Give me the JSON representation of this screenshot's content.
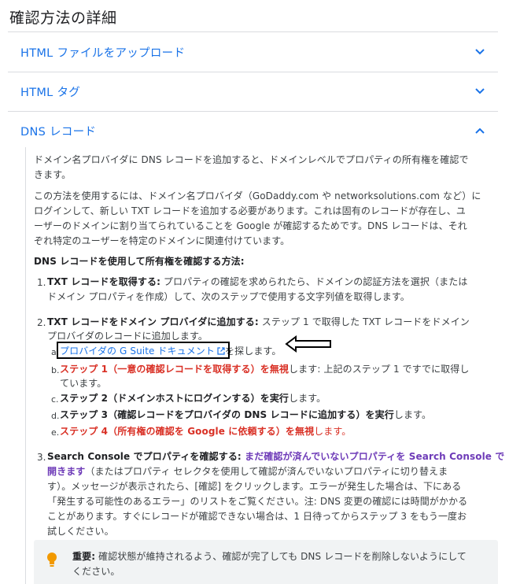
{
  "page_title": "確認方法の詳細",
  "accordions": [
    {
      "title": "HTML ファイルをアップロード",
      "expanded": false
    },
    {
      "title": "HTML タグ",
      "expanded": false
    },
    {
      "title": "DNS レコード",
      "expanded": true
    }
  ],
  "dns": {
    "intro1_line1": "ドメイン名プロバイダに DNS レコードを追加すると、ドメインレベルでプロパティの所有権を確認で",
    "intro1_line2": "きます。",
    "intro2_line1": "この方法を使用するには、ドメイン名プロバイダ（GoDaddy.com や networksolutions.com など）に",
    "intro2_line2": "ログインして、新しい TXT レコードを追加する必要があります。これは固有のレコードが存在し、ユ",
    "intro2_line3": "ーザーのドメインに割り当てられていることを Google が確認するためです。DNS レコードは、それ",
    "intro2_line4": "ぞれ特定のユーザーを特定のドメインに関連付けています。",
    "heading": "DNS レコードを使用して所有権を確認する方法:",
    "step1": {
      "num": "1.",
      "bold": "TXT レコードを取得する:",
      "line1": " プロパティの確認を求められたら、ドメインの認証方法を選択（または",
      "line2": "ドメイン プロパティを作成）して、次のステップで使用する文字列値を取得します。"
    },
    "step2": {
      "num": "2.",
      "bold": "TXT レコードをドメイン プロバイダに追加する:",
      "line1": " ステップ 1 で取得した TXT レコードをドメイン",
      "line2": "プロバイダのレコードに追加します。",
      "sub_a": {
        "num": "a.",
        "link": "プロバイダの G Suite ドキュメント",
        "rest": "を探します。"
      },
      "sub_b": {
        "num": "b.",
        "red": "ステップ 1（一意の確認レコードを取得する）を無視",
        "rest": "します: 上記のステップ 1 ですでに取得し",
        "rest2": "ています。"
      },
      "sub_c": {
        "num": "c.",
        "bold": "ステップ 2（ドメインホストにログインする）を実行",
        "rest": "します。"
      },
      "sub_d": {
        "num": "d.",
        "bold": "ステップ 3（確認レコードをプロバイダの DNS レコードに追加する）を実行",
        "rest": "します。"
      },
      "sub_e": {
        "num": "e.",
        "red": "ステップ 4（所有権の確認を Google に依頼する）を無視",
        "rest": "します。"
      }
    },
    "step3": {
      "num": "3.",
      "bold": "Search Console でプロパティを確認する:",
      "purple1": " まだ確認が済んでいないプロパティを Search Console で",
      "purple2": "開きます",
      "line2_rest": "（またはプロパティ セレクタを使用して確認が済んでいないプロパティに切り替えま",
      "line3": "す）。メッセージが表示されたら、[確認] をクリックします。エラーが発生した場合は、下にある",
      "line4": "「発生する可能性のあるエラー」のリストをご覧ください。注: DNS 変更の確認には時間がかかる",
      "line5": "ことがあります。すぐにレコードが確認できない場合は、1 日待ってからステップ 3 をもう一度お",
      "line6": "試しください。"
    },
    "note": {
      "bold": "重要:",
      "line1": " 確認状態が維持されるよう、確認が完了しても DNS レコードを削除しないようにして",
      "line2": "ください。"
    }
  },
  "colors": {
    "link": "#1a73e8",
    "warn": "#d93025",
    "purple": "#6e3bb8",
    "bulb": "#f29900"
  },
  "icons": {
    "collapsed": "chevron-down-icon",
    "expanded": "chevron-up-icon",
    "external": "external-link-icon",
    "bulb": "lightbulb-icon"
  }
}
